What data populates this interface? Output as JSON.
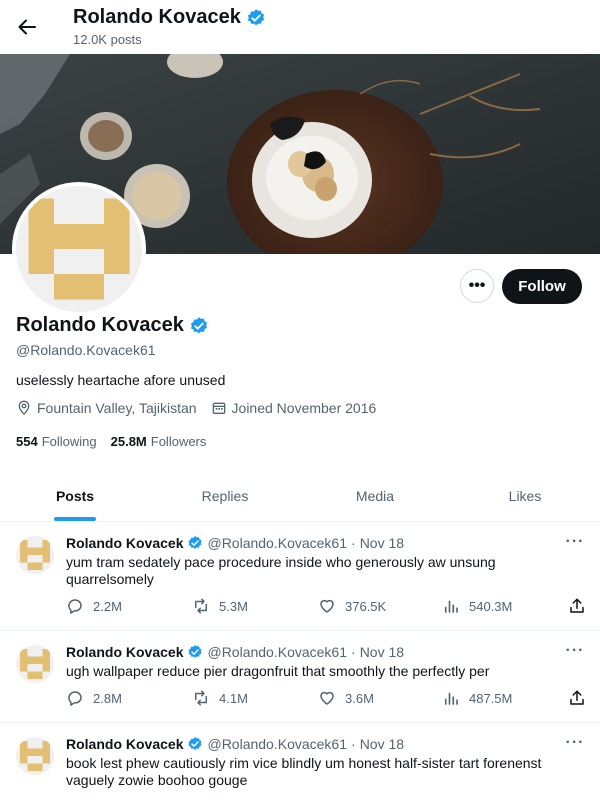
{
  "header": {
    "title": "Rolando Kovacek",
    "post_count": "12.0K posts",
    "back_icon": "arrow-left-icon"
  },
  "profile": {
    "name": "Rolando Kovacek",
    "handle": "@Rolando.Kovacek61",
    "bio": "uselessly heartache afore unused",
    "location": "Fountain Valley, Tajikistan",
    "joined": "Joined November 2016",
    "following_count": "554",
    "following_label": "Following",
    "followers_count": "25.8M",
    "followers_label": "Followers",
    "follow_label": "Follow",
    "more_label": "•••",
    "verified": true
  },
  "colors": {
    "accent": "#1d9bf0",
    "text_primary": "#0f1419",
    "text_secondary": "#536471",
    "avatar_pattern": "#e2bf72"
  },
  "tabs": [
    {
      "label": "Posts",
      "active": true
    },
    {
      "label": "Replies",
      "active": false
    },
    {
      "label": "Media",
      "active": false
    },
    {
      "label": "Likes",
      "active": false
    }
  ],
  "tweets": [
    {
      "name": "Rolando Kovacek",
      "handle": "@Rolando.Kovacek61",
      "dot": "·",
      "date": "Nov 18",
      "text": "yum tram sedately pace procedure inside who generously aw unsung quarrelsomely",
      "replies": "2.2M",
      "reposts": "5.3M",
      "likes": "376.5K",
      "views": "540.3M"
    },
    {
      "name": "Rolando Kovacek",
      "handle": "@Rolando.Kovacek61",
      "dot": "·",
      "date": "Nov 18",
      "text": "ugh wallpaper reduce pier dragonfruit that smoothly the perfectly per",
      "replies": "2.8M",
      "reposts": "4.1M",
      "likes": "3.6M",
      "views": "487.5M"
    },
    {
      "name": "Rolando Kovacek",
      "handle": "@Rolando.Kovacek61",
      "dot": "·",
      "date": "Nov 18",
      "text": "book lest phew cautiously rim vice blindly um honest half-sister tart forenenst vaguely zowie boohoo gouge",
      "replies": "",
      "reposts": "",
      "likes": "",
      "views": ""
    }
  ]
}
